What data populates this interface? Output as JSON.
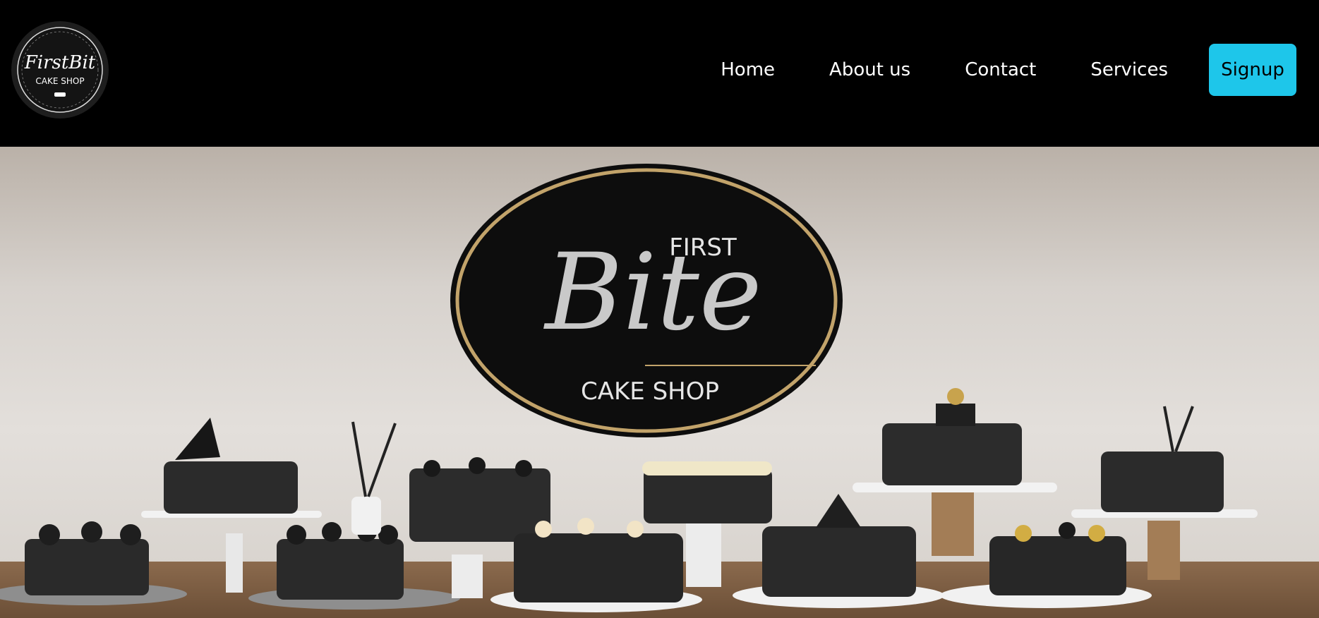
{
  "logo": {
    "line1": "FirstBit",
    "line2": "CAKE SHOP"
  },
  "nav": {
    "home": "Home",
    "about": "About us",
    "contact": "Contact",
    "services": "Services",
    "signup": "Signup"
  },
  "hero": {
    "emblem_first": "FIRST",
    "emblem_bite": "Bite",
    "emblem_cake_shop": "CAKE SHOP"
  },
  "colors": {
    "accent": "#1ec6ea",
    "nav_bg": "#000000",
    "gold": "#c2a36a"
  }
}
